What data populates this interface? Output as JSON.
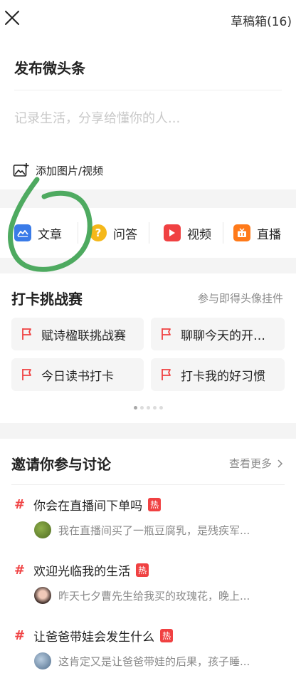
{
  "header": {
    "drafts_label": "草稿箱(16)"
  },
  "compose": {
    "title": "发布微头条",
    "placeholder": "记录生活，分享给懂你的人...",
    "add_media_label": "添加图片/视频"
  },
  "post_types": [
    {
      "label": "文章",
      "icon": "article-icon",
      "color": "#3a7be8"
    },
    {
      "label": "问答",
      "icon": "question-icon",
      "color": "#f5b81a"
    },
    {
      "label": "视频",
      "icon": "video-play-icon",
      "color": "#f04142"
    },
    {
      "label": "直播",
      "icon": "live-tv-icon",
      "color": "#ff7a1a"
    }
  ],
  "challenge": {
    "title": "打卡挑战赛",
    "link": "参与即得头像挂件",
    "items": [
      "赋诗楹联挑战赛",
      "聊聊今天的开…",
      "今日读书打卡",
      "打卡我的好习惯"
    ],
    "page_count": 5,
    "active_page": 0
  },
  "discuss": {
    "title": "邀请你参与讨论",
    "more": "查看更多",
    "topics": [
      {
        "title": "你会在直播间下单吗",
        "hot": "热",
        "preview": "我在直播间买了一瓶豆腐乳，是残疾军..."
      },
      {
        "title": "欢迎光临我的生活",
        "hot": "热",
        "preview": "昨天七夕曹先生给我买的玫瑰花，晚上..."
      },
      {
        "title": "让爸爸带娃会发生什么",
        "hot": "热",
        "preview": "这肯定又是让爸爸带娃的后果，孩子睡..."
      }
    ]
  },
  "colors": {
    "accent_red": "#f04142",
    "annotation_green": "#3fa352"
  }
}
